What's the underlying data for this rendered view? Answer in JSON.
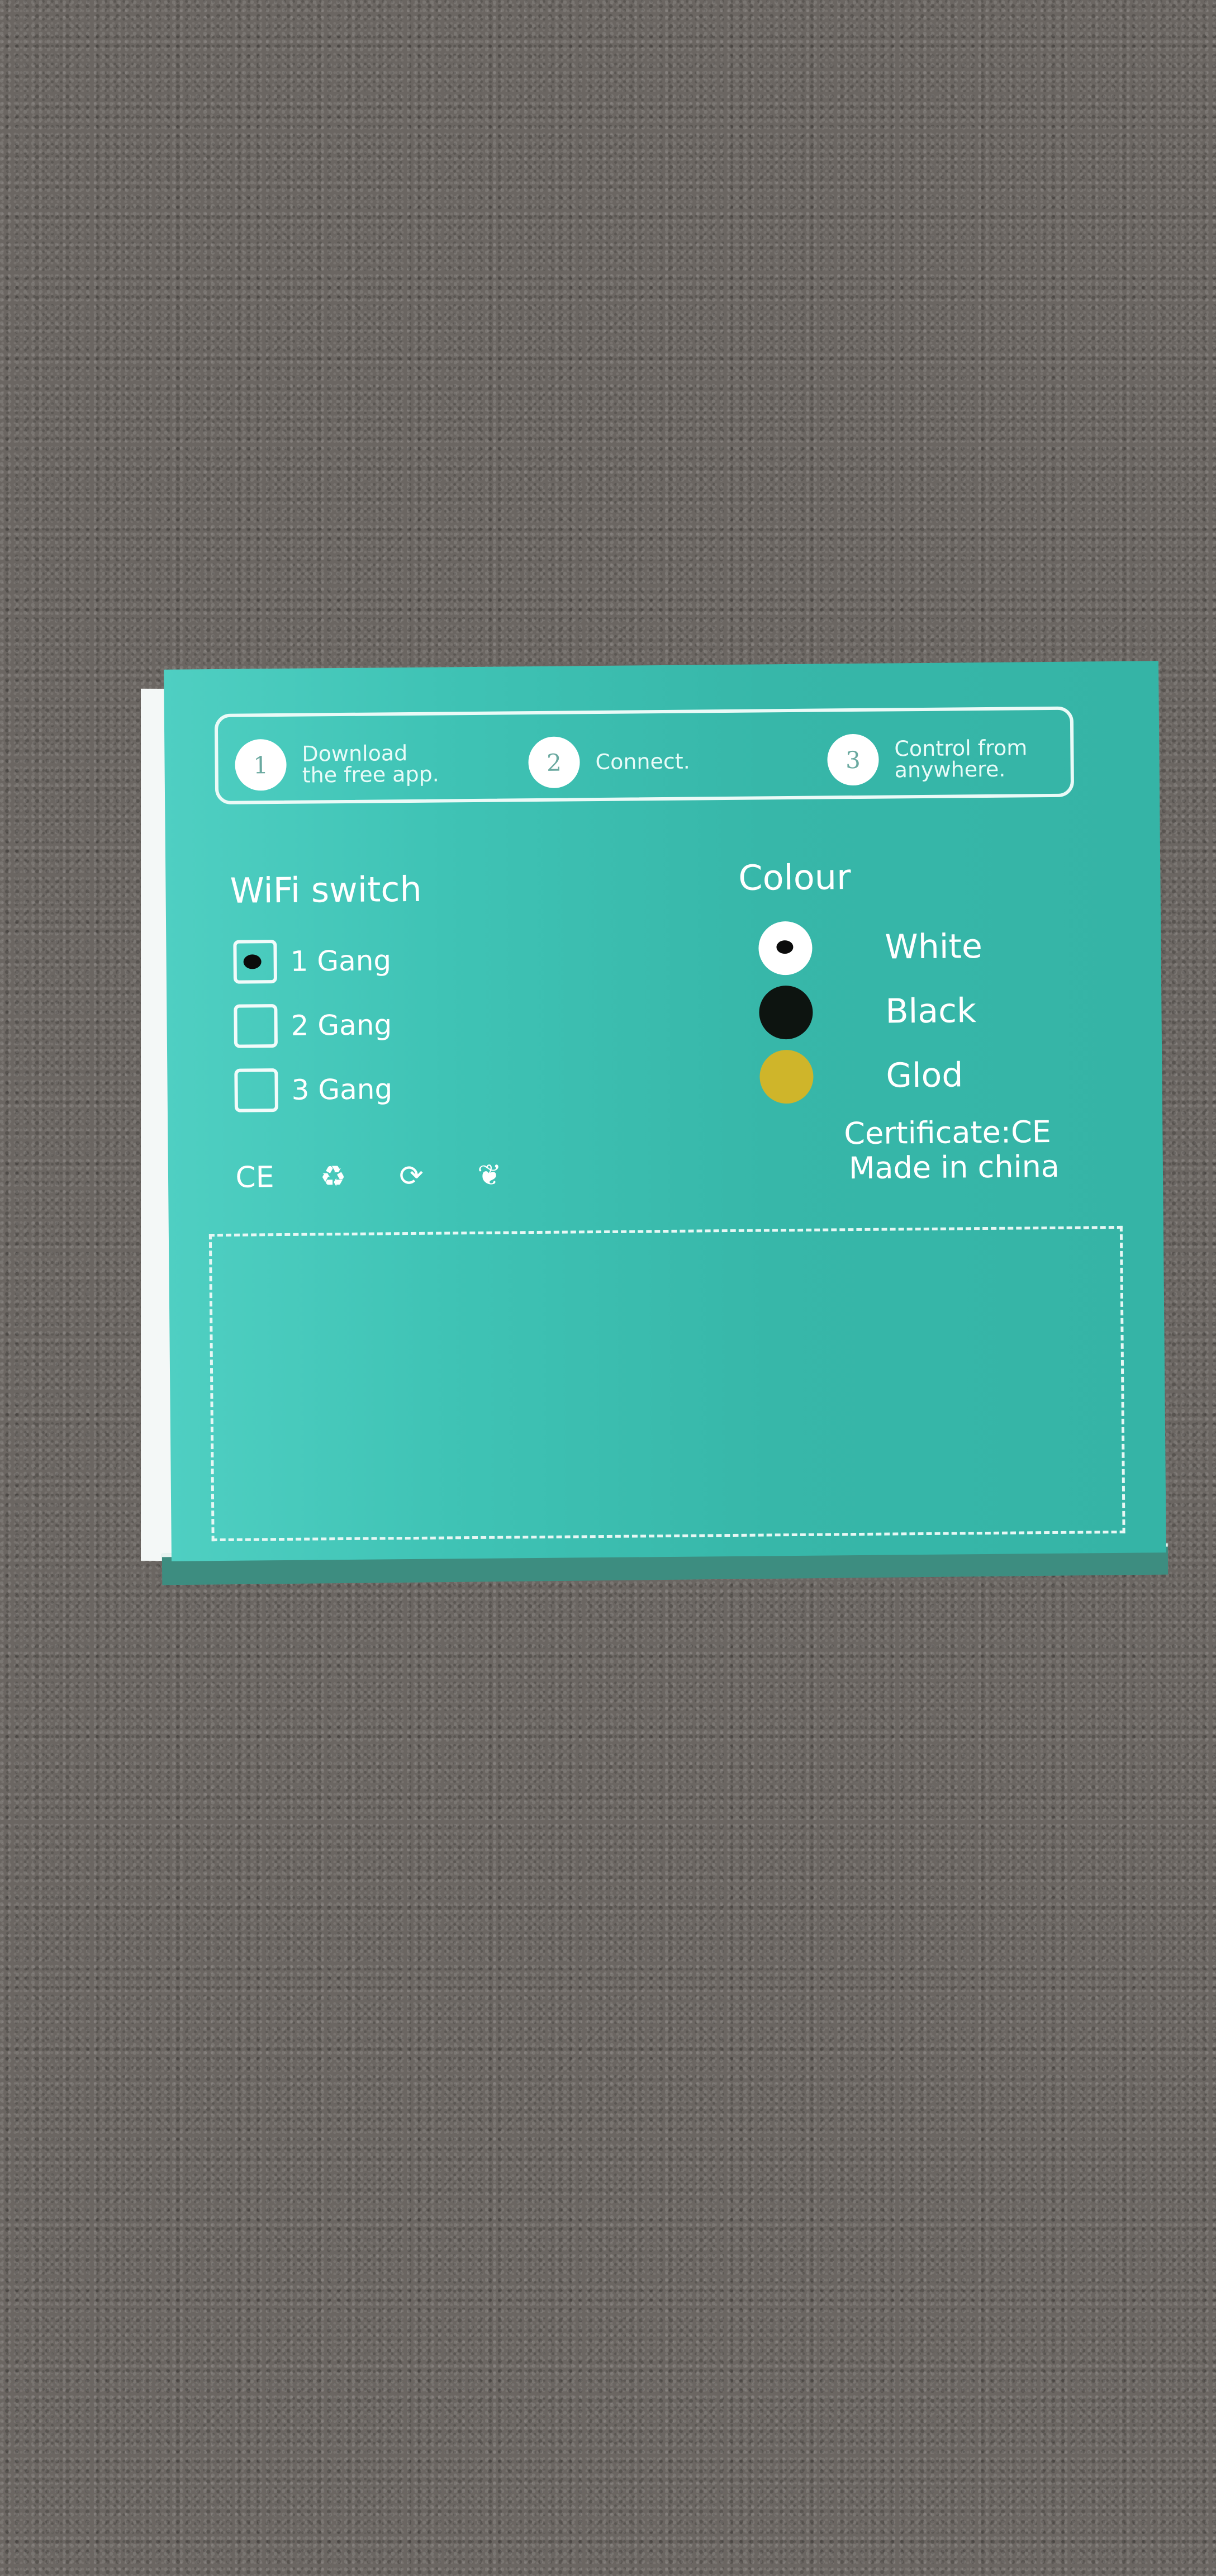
{
  "scene": "Photo of the back of a teal product box lying on a grey carpet",
  "steps": [
    {
      "number": "1",
      "text": "Download\nthe free app."
    },
    {
      "number": "2",
      "text": "Connect."
    },
    {
      "number": "3",
      "text": "Control from\nanywhere."
    }
  ],
  "wifi_switch": {
    "title": "WiFi switch",
    "options": [
      {
        "label": "1 Gang",
        "checked": true
      },
      {
        "label": "2 Gang",
        "checked": false
      },
      {
        "label": "3 Gang",
        "checked": false
      }
    ]
  },
  "certifications": [
    {
      "icon": "ce-mark-icon",
      "glyph": "CE"
    },
    {
      "icon": "recycle-icon",
      "glyph": "♻"
    },
    {
      "icon": "green-dot-icon",
      "glyph": "⟳"
    },
    {
      "icon": "rohs-icon",
      "glyph": "❦"
    }
  ],
  "colour": {
    "title": "Colour",
    "options": [
      {
        "label": "White",
        "hex": "#ffffff",
        "selected": true
      },
      {
        "label": "Black",
        "hex": "#0d1410",
        "selected": false
      },
      {
        "label": "Glod",
        "hex": "#cfb52a",
        "selected": false
      }
    ]
  },
  "info": {
    "certificate": "Certificate:CE",
    "origin": "Made in china"
  },
  "colors": {
    "box_teal": "#3fc3b5",
    "carpet_grey": "#6b6662"
  }
}
